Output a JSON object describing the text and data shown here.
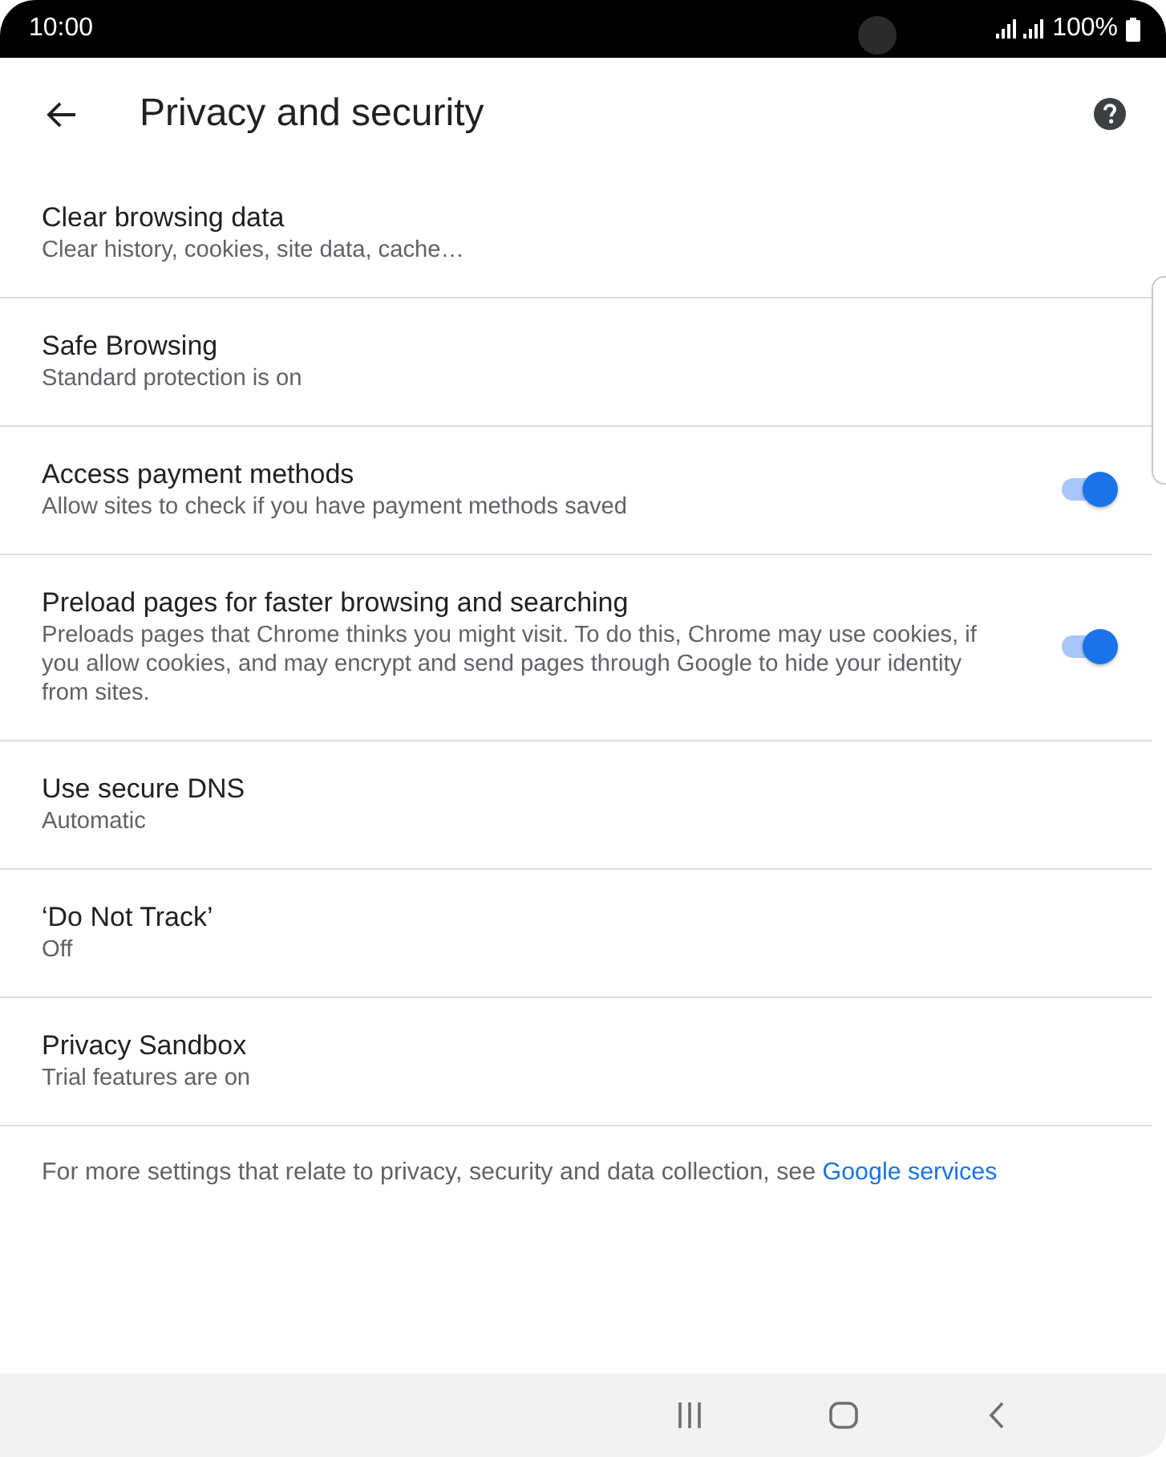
{
  "status_bar": {
    "time": "10:00",
    "battery": "100%"
  },
  "app_bar": {
    "title": "Privacy and security"
  },
  "settings": [
    {
      "kind": "item",
      "title": "Clear browsing data",
      "summary": "Clear history, cookies, site data, cache…"
    },
    {
      "kind": "item",
      "title": "Safe Browsing",
      "summary": "Standard protection is on"
    },
    {
      "kind": "toggle",
      "title": "Access payment methods",
      "summary": "Allow sites to check if you have payment methods saved",
      "on": true
    },
    {
      "kind": "toggle",
      "title": "Preload pages for faster browsing and searching",
      "summary": "Preloads pages that Chrome thinks you might visit. To do this, Chrome may use cookies, if you allow cookies, and may encrypt and send pages through Google to hide your identity from sites.",
      "on": true
    },
    {
      "kind": "item",
      "title": "Use secure DNS",
      "summary": "Automatic"
    },
    {
      "kind": "item",
      "title": "‘Do Not Track’",
      "summary": "Off"
    },
    {
      "kind": "item",
      "title": "Privacy Sandbox",
      "summary": "Trial features are on"
    }
  ],
  "footer": {
    "text": "For more settings that relate to privacy, security and data collection, see",
    "link": "Google services"
  }
}
